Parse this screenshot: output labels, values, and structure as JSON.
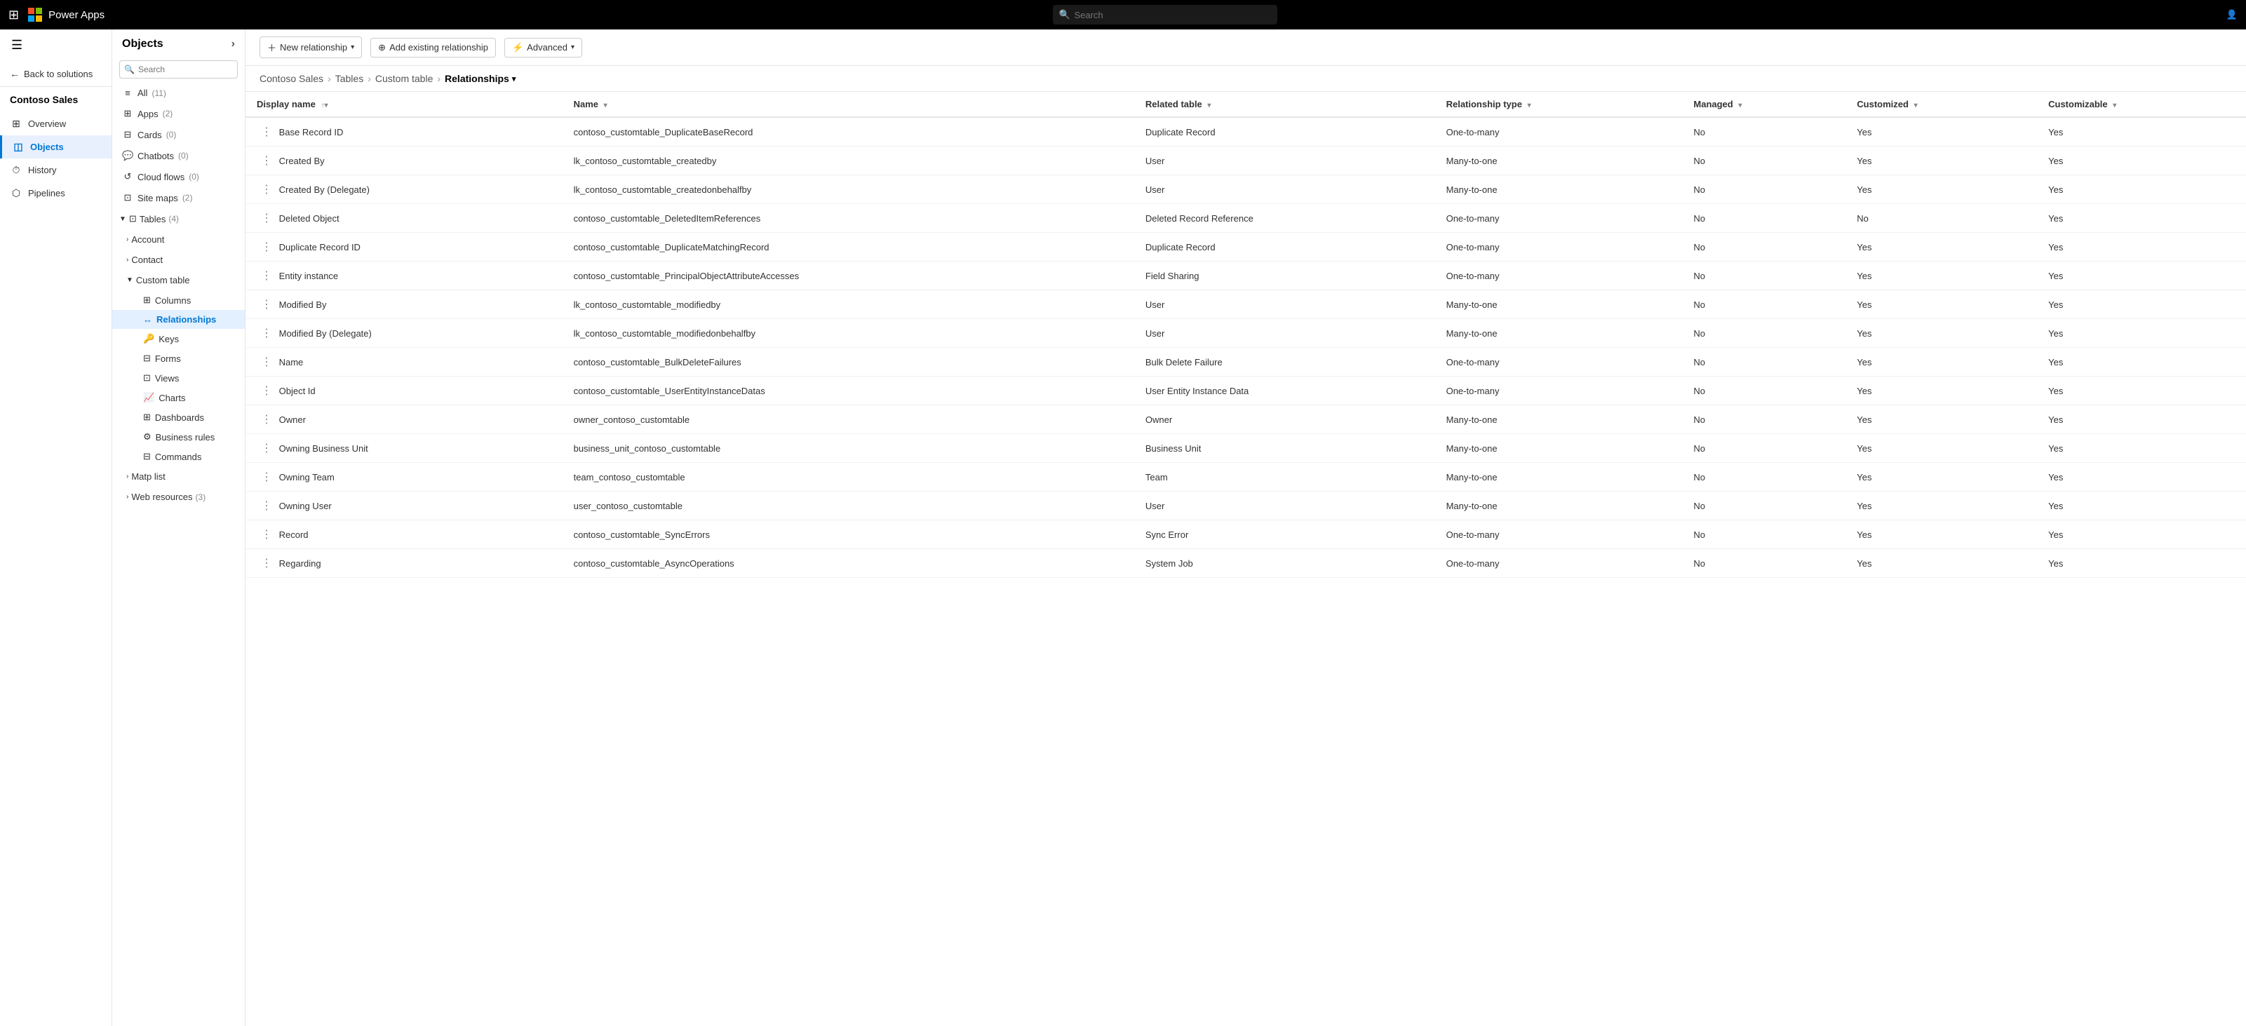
{
  "topbar": {
    "appname": "Power Apps",
    "search_placeholder": "Search"
  },
  "left_nav": {
    "back_label": "Back to solutions",
    "solution_title": "Contoso Sales",
    "items": [
      {
        "id": "overview",
        "label": "Overview",
        "icon": "⊞"
      },
      {
        "id": "objects",
        "label": "Objects",
        "icon": "◫",
        "active": true
      },
      {
        "id": "history",
        "label": "History",
        "icon": "⏱"
      },
      {
        "id": "pipelines",
        "label": "Pipelines",
        "icon": "⬡"
      }
    ]
  },
  "sidebar": {
    "title": "Objects",
    "search_placeholder": "Search",
    "items": [
      {
        "id": "all",
        "label": "All",
        "count": "(11)",
        "icon": "≡"
      },
      {
        "id": "apps",
        "label": "Apps",
        "count": "(2)",
        "icon": "⊞"
      },
      {
        "id": "cards",
        "label": "Cards",
        "count": "(0)",
        "icon": "⊟"
      },
      {
        "id": "chatbots",
        "label": "Chatbots",
        "count": "(0)",
        "icon": "💬"
      },
      {
        "id": "cloudflows",
        "label": "Cloud flows",
        "count": "(0)",
        "icon": "↺"
      },
      {
        "id": "sitemaps",
        "label": "Site maps",
        "count": "(2)",
        "icon": "⊡"
      }
    ],
    "tables_group": {
      "label": "Tables",
      "count": "(4)",
      "expanded": true,
      "children": [
        {
          "id": "account",
          "label": "Account",
          "expanded": false
        },
        {
          "id": "contact",
          "label": "Contact",
          "expanded": false
        },
        {
          "id": "customtable",
          "label": "Custom table",
          "expanded": true,
          "children": [
            {
              "id": "columns",
              "label": "Columns",
              "icon": "⊞",
              "active": false
            },
            {
              "id": "relationships",
              "label": "Relationships",
              "icon": "↔",
              "active": true
            },
            {
              "id": "keys",
              "label": "Keys",
              "icon": "🔑",
              "active": false
            },
            {
              "id": "forms",
              "label": "Forms",
              "icon": "⊟",
              "active": false
            },
            {
              "id": "views",
              "label": "Views",
              "icon": "⊡",
              "active": false
            },
            {
              "id": "charts",
              "label": "Charts",
              "icon": "📈",
              "active": false
            },
            {
              "id": "dashboards",
              "label": "Dashboards",
              "icon": "⊞",
              "active": false
            },
            {
              "id": "businessrules",
              "label": "Business rules",
              "icon": "⚙",
              "active": false
            },
            {
              "id": "commands",
              "label": "Commands",
              "icon": "⊟",
              "active": false
            }
          ]
        },
        {
          "id": "matplist",
          "label": "Matp list",
          "expanded": false
        },
        {
          "id": "webresources",
          "label": "Web resources",
          "count": "(3)",
          "expanded": false
        }
      ]
    }
  },
  "toolbar": {
    "new_relationship": "New relationship",
    "add_existing": "Add existing relationship",
    "advanced": "Advanced"
  },
  "breadcrumb": {
    "items": [
      "Contoso Sales",
      "Tables",
      "Custom table"
    ],
    "current": "Relationships"
  },
  "table": {
    "columns": [
      {
        "id": "display_name",
        "label": "Display name",
        "sortable": true
      },
      {
        "id": "name",
        "label": "Name",
        "sortable": true
      },
      {
        "id": "related_table",
        "label": "Related table",
        "sortable": true
      },
      {
        "id": "relationship_type",
        "label": "Relationship type",
        "sortable": true
      },
      {
        "id": "managed",
        "label": "Managed",
        "sortable": true
      },
      {
        "id": "customized",
        "label": "Customized",
        "sortable": true
      },
      {
        "id": "customizable",
        "label": "Customizable",
        "sortable": true
      }
    ],
    "rows": [
      {
        "display_name": "Base Record ID",
        "name": "contoso_customtable_DuplicateBaseRecord",
        "related_table": "Duplicate Record",
        "relationship_type": "One-to-many",
        "managed": "No",
        "customized": "Yes",
        "customizable": "Yes"
      },
      {
        "display_name": "Created By",
        "name": "lk_contoso_customtable_createdby",
        "related_table": "User",
        "relationship_type": "Many-to-one",
        "managed": "No",
        "customized": "Yes",
        "customizable": "Yes"
      },
      {
        "display_name": "Created By (Delegate)",
        "name": "lk_contoso_customtable_createdonbehalfby",
        "related_table": "User",
        "relationship_type": "Many-to-one",
        "managed": "No",
        "customized": "Yes",
        "customizable": "Yes"
      },
      {
        "display_name": "Deleted Object",
        "name": "contoso_customtable_DeletedItemReferences",
        "related_table": "Deleted Record Reference",
        "relationship_type": "One-to-many",
        "managed": "No",
        "customized": "No",
        "customizable": "Yes"
      },
      {
        "display_name": "Duplicate Record ID",
        "name": "contoso_customtable_DuplicateMatchingRecord",
        "related_table": "Duplicate Record",
        "relationship_type": "One-to-many",
        "managed": "No",
        "customized": "Yes",
        "customizable": "Yes"
      },
      {
        "display_name": "Entity instance",
        "name": "contoso_customtable_PrincipalObjectAttributeAccesses",
        "related_table": "Field Sharing",
        "relationship_type": "One-to-many",
        "managed": "No",
        "customized": "Yes",
        "customizable": "Yes"
      },
      {
        "display_name": "Modified By",
        "name": "lk_contoso_customtable_modifiedby",
        "related_table": "User",
        "relationship_type": "Many-to-one",
        "managed": "No",
        "customized": "Yes",
        "customizable": "Yes"
      },
      {
        "display_name": "Modified By (Delegate)",
        "name": "lk_contoso_customtable_modifiedonbehalfby",
        "related_table": "User",
        "relationship_type": "Many-to-one",
        "managed": "No",
        "customized": "Yes",
        "customizable": "Yes"
      },
      {
        "display_name": "Name",
        "name": "contoso_customtable_BulkDeleteFailures",
        "related_table": "Bulk Delete Failure",
        "relationship_type": "One-to-many",
        "managed": "No",
        "customized": "Yes",
        "customizable": "Yes"
      },
      {
        "display_name": "Object Id",
        "name": "contoso_customtable_UserEntityInstanceDatas",
        "related_table": "User Entity Instance Data",
        "relationship_type": "One-to-many",
        "managed": "No",
        "customized": "Yes",
        "customizable": "Yes"
      },
      {
        "display_name": "Owner",
        "name": "owner_contoso_customtable",
        "related_table": "Owner",
        "relationship_type": "Many-to-one",
        "managed": "No",
        "customized": "Yes",
        "customizable": "Yes"
      },
      {
        "display_name": "Owning Business Unit",
        "name": "business_unit_contoso_customtable",
        "related_table": "Business Unit",
        "relationship_type": "Many-to-one",
        "managed": "No",
        "customized": "Yes",
        "customizable": "Yes"
      },
      {
        "display_name": "Owning Team",
        "name": "team_contoso_customtable",
        "related_table": "Team",
        "relationship_type": "Many-to-one",
        "managed": "No",
        "customized": "Yes",
        "customizable": "Yes"
      },
      {
        "display_name": "Owning User",
        "name": "user_contoso_customtable",
        "related_table": "User",
        "relationship_type": "Many-to-one",
        "managed": "No",
        "customized": "Yes",
        "customizable": "Yes"
      },
      {
        "display_name": "Record",
        "name": "contoso_customtable_SyncErrors",
        "related_table": "Sync Error",
        "relationship_type": "One-to-many",
        "managed": "No",
        "customized": "Yes",
        "customizable": "Yes"
      },
      {
        "display_name": "Regarding",
        "name": "contoso_customtable_AsyncOperations",
        "related_table": "System Job",
        "relationship_type": "One-to-many",
        "managed": "No",
        "customized": "Yes",
        "customizable": "Yes"
      }
    ]
  }
}
